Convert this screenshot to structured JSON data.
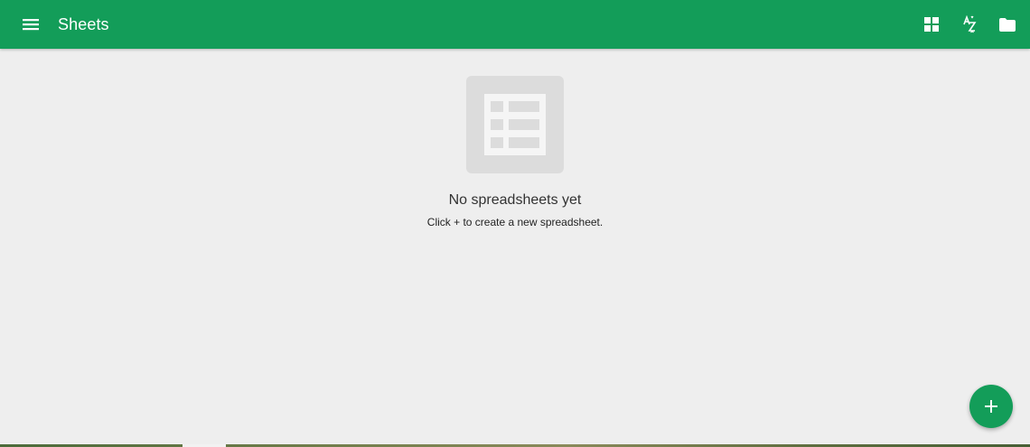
{
  "app": {
    "title": "Sheets"
  },
  "header": {
    "menu_icon": "hamburger-menu-icon",
    "actions": [
      {
        "name": "grid-view-icon"
      },
      {
        "name": "sort-az-icon"
      },
      {
        "name": "folder-icon"
      }
    ]
  },
  "empty_state": {
    "graphic_icon": "spreadsheet-icon",
    "title": "No spreadsheets yet",
    "subtitle": "Click + to create a new spreadsheet."
  },
  "fab": {
    "icon": "plus-icon"
  },
  "colors": {
    "primary": "#139d59",
    "background": "#eeeeee",
    "placeholder": "#dcdcdc"
  }
}
